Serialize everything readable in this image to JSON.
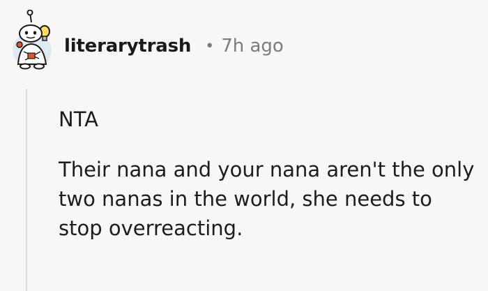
{
  "comment": {
    "author": "literarytrash",
    "separator": "•",
    "time": "7h ago",
    "paragraphs": [
      "NTA",
      "Their nana and your nana aren't the only two nanas in the world, she needs to stop overreacting."
    ]
  },
  "avatar": {
    "icon": "reddit-snoo-avatar-icon",
    "colors": {
      "outline": "#1a1a1a",
      "body": "#ffffff",
      "bulb": "#ffd866",
      "accent": "#d9572e",
      "tint": "#dfe9f0"
    }
  },
  "theme": {
    "background": "#f8f7f5",
    "text": "#1c1c1c",
    "muted": "#7c7c7c",
    "thread_line": "#dcdcdc"
  }
}
